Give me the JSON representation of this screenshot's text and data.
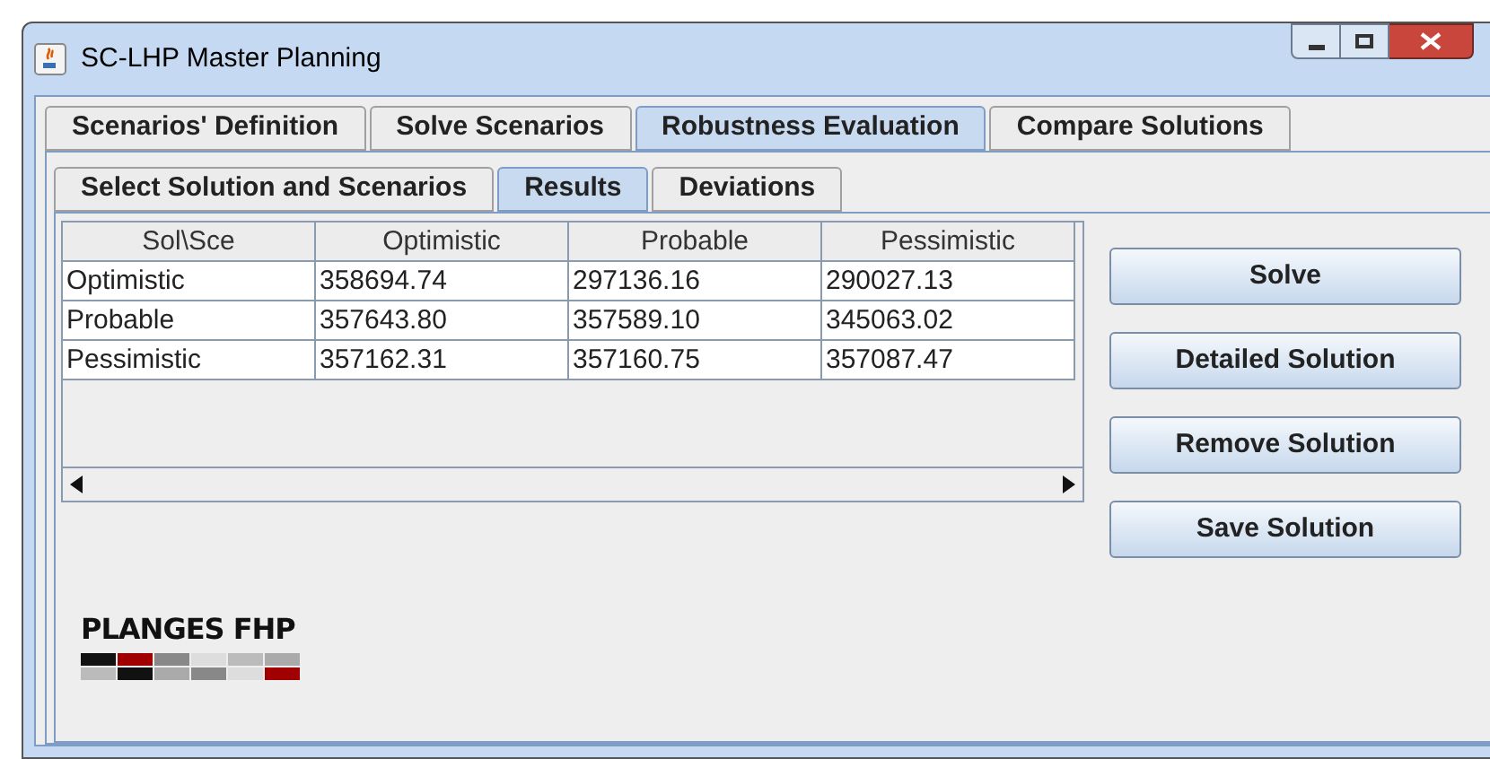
{
  "window": {
    "title": "SC-LHP Master Planning"
  },
  "tabs": [
    {
      "label": "Scenarios' Definition",
      "selected": false
    },
    {
      "label": "Solve Scenarios",
      "selected": false
    },
    {
      "label": "Robustness Evaluation",
      "selected": true
    },
    {
      "label": "Compare Solutions",
      "selected": false
    }
  ],
  "subtabs": [
    {
      "label": "Select Solution and Scenarios",
      "selected": false
    },
    {
      "label": "Results",
      "selected": true
    },
    {
      "label": "Deviations",
      "selected": false
    }
  ],
  "table": {
    "columns": [
      "Sol\\Sce",
      "Optimistic",
      "Probable",
      "Pessimistic"
    ],
    "rows": [
      [
        "Optimistic",
        "358694.74",
        "297136.16",
        "290027.13"
      ],
      [
        "Probable",
        "357643.80",
        "357589.10",
        "345063.02"
      ],
      [
        "Pessimistic",
        "357162.31",
        "357160.75",
        "357087.47"
      ]
    ]
  },
  "buttons": [
    "Solve",
    "Detailed Solution",
    "Remove Solution",
    "Save Solution"
  ],
  "logo": {
    "text": "PLANGES FHP"
  }
}
